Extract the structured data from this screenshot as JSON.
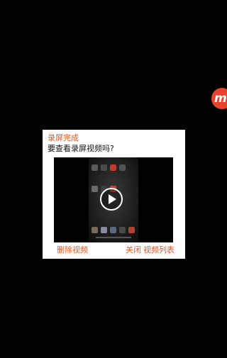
{
  "floating_button": {
    "glyph": "m",
    "color": "#e8432e",
    "icon": "recorder-logo-icon"
  },
  "dialog": {
    "title": "录屏完成",
    "message": "要查看录屏视频吗?",
    "preview": {
      "icon": "play-icon"
    },
    "actions": {
      "delete_label": "删除视频",
      "close_label": "关闭",
      "list_label": "视频列表"
    },
    "accent_color": "#e8561e"
  }
}
